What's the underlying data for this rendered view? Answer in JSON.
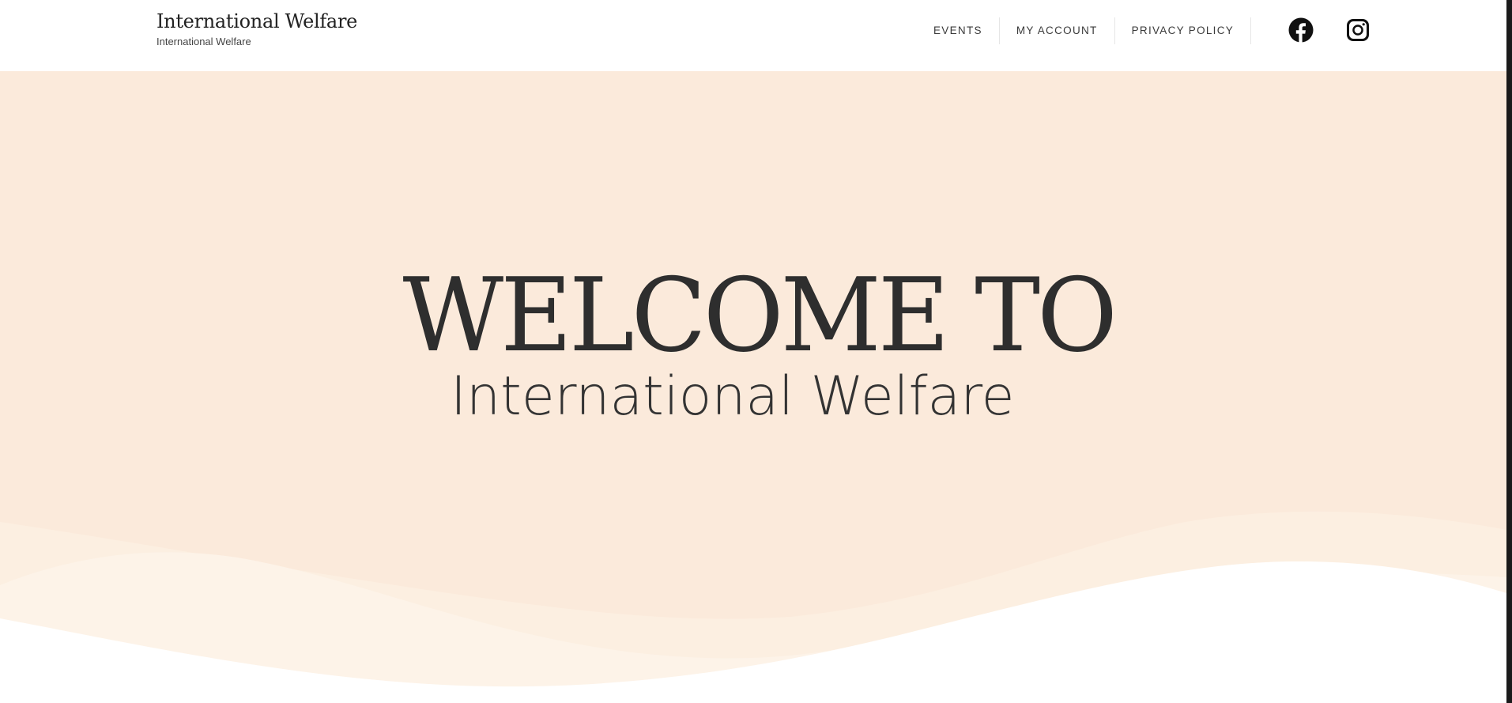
{
  "site": {
    "title": "International Welfare",
    "tagline": "International Welfare"
  },
  "nav": {
    "items": [
      {
        "label": "EVENTS"
      },
      {
        "label": "MY ACCOUNT"
      },
      {
        "label": "PRIVACY POLICY"
      }
    ]
  },
  "social": {
    "links": [
      {
        "icon": "facebook-icon"
      },
      {
        "icon": "instagram-icon"
      }
    ]
  },
  "hero": {
    "heading": "WELCOME TO",
    "subheading": "International Welfare"
  },
  "colors": {
    "hero_background": "#fbeadb",
    "wave_light": "#fcf2e6",
    "wave_lighter": "#fdf5ec",
    "text_dark": "#2e2e2e"
  }
}
